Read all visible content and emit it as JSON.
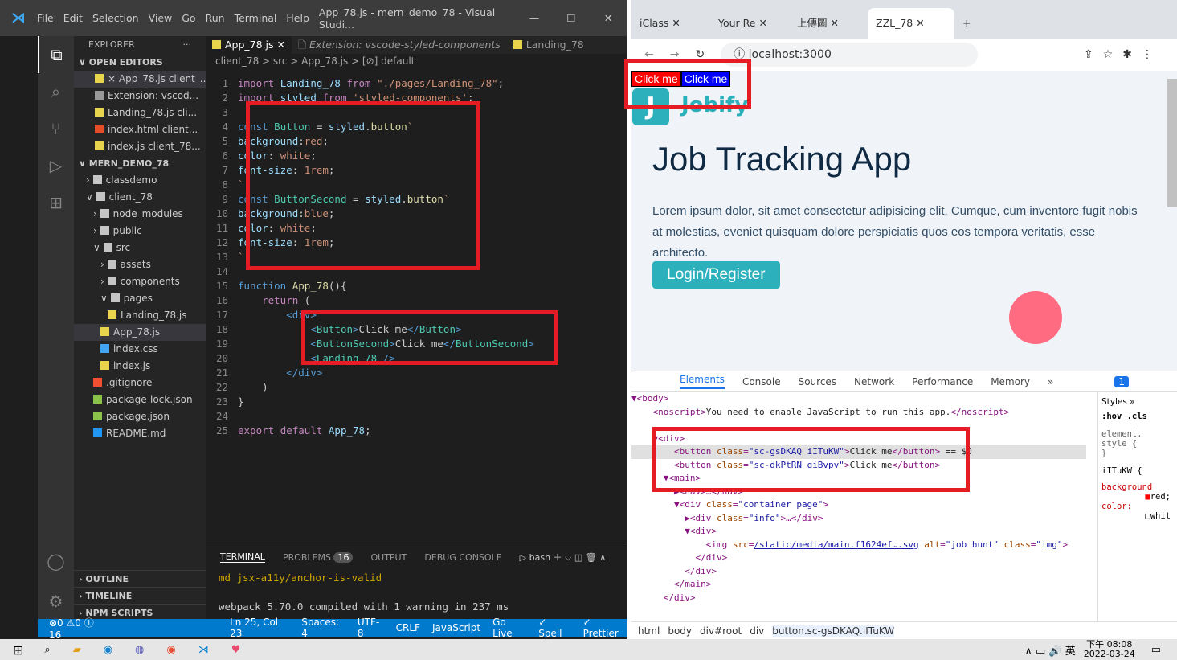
{
  "vscode": {
    "title": "App_78.js - mern_demo_78 - Visual Studi...",
    "menu": [
      "File",
      "Edit",
      "Selection",
      "View",
      "Go",
      "Run",
      "Terminal",
      "Help"
    ],
    "explorer": "EXPLORER",
    "open_editors": "OPEN EDITORS",
    "open_files": [
      {
        "name": "× App_78.js client_...",
        "type": "js",
        "selected": true
      },
      {
        "name": "Extension: vscod...",
        "type": "doc"
      },
      {
        "name": "Landing_78.js cli...",
        "type": "js"
      },
      {
        "name": "index.html client...",
        "type": "html"
      },
      {
        "name": "index.js client_78...",
        "type": "js"
      }
    ],
    "project": "MERN_DEMO_78",
    "tree": [
      {
        "name": "classdemo",
        "indent": 1,
        "type": "folder"
      },
      {
        "name": "client_78",
        "indent": 1,
        "type": "folder-open"
      },
      {
        "name": "node_modules",
        "indent": 2,
        "type": "folder"
      },
      {
        "name": "public",
        "indent": 2,
        "type": "folder"
      },
      {
        "name": "src",
        "indent": 2,
        "type": "folder-open"
      },
      {
        "name": "assets",
        "indent": 3,
        "type": "folder"
      },
      {
        "name": "components",
        "indent": 3,
        "type": "folder"
      },
      {
        "name": "pages",
        "indent": 3,
        "type": "folder-open"
      },
      {
        "name": "Landing_78.js",
        "indent": 4,
        "type": "js"
      },
      {
        "name": "App_78.js",
        "indent": 3,
        "type": "js",
        "selected": true
      },
      {
        "name": "index.css",
        "indent": 3,
        "type": "css"
      },
      {
        "name": "index.js",
        "indent": 3,
        "type": "js"
      },
      {
        "name": ".gitignore",
        "indent": 2,
        "type": "git"
      },
      {
        "name": "package-lock.json",
        "indent": 2,
        "type": "json"
      },
      {
        "name": "package.json",
        "indent": 2,
        "type": "json"
      },
      {
        "name": "README.md",
        "indent": 2,
        "type": "info"
      }
    ],
    "bottom_sections": [
      "OUTLINE",
      "TIMELINE",
      "NPM SCRIPTS"
    ],
    "tabs": [
      "App_78.js",
      "Extension: vscode-styled-components",
      "Landing_78"
    ],
    "breadcrumb": "client_78 > src > App_78.js > [⊘] default",
    "terminal_tabs": [
      "TERMINAL",
      "PROBLEMS",
      "OUTPUT",
      "DEBUG CONSOLE"
    ],
    "problems_count": "16",
    "shell": "bash",
    "terminal_lines": [
      "md  jsx-a11y/anchor-is-valid",
      "",
      "webpack 5.70.0 compiled with 1 warning in 237 ms"
    ],
    "status": [
      "⊗0 ⚠0 ⓘ 16",
      "Ln 25, Col 23",
      "Spaces: 4",
      "UTF-8",
      "CRLF",
      "JavaScript",
      "Go Live",
      "✓ Spell",
      "✓ Prettier"
    ]
  },
  "chrome": {
    "tabs": [
      "iClass",
      "Your Re",
      "上傳圖",
      "ZZL_78"
    ],
    "url": "localhost:3000",
    "button1": "Click me",
    "button2": "Click me",
    "logo": "Jobify",
    "heading": "Job Tracking App",
    "paragraph": "Lorem ipsum dolor, sit amet consectetur adipisicing elit. Cumque, cum inventore fugit nobis at molestias, eveniet quisquam dolore perspiciatis quos eos tempora veritatis, esse architecto.",
    "cta": "Login/Register",
    "devtools_tabs": [
      "Elements",
      "Console",
      "Sources",
      "Network",
      "Performance",
      "Memory",
      "»"
    ],
    "noscript": "You need to enable JavaScript to run this app.",
    "img_src": "/static/media/main.f1624ef….svg",
    "styles_tab": "Styles",
    "filter": ":hov .cls",
    "breadcrumb": [
      "html",
      "body",
      "div#root",
      "div",
      "button.sc-gsDKAQ.iITuKW"
    ],
    "badge": "1"
  },
  "taskbar": {
    "time": "下午 08:08",
    "date": "2022-03-24",
    "ime": "英"
  }
}
